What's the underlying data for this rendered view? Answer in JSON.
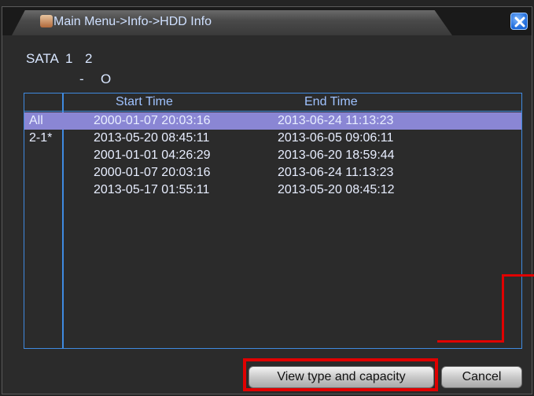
{
  "window": {
    "title": "Main Menu->Info->HDD Info"
  },
  "sata": {
    "label": "SATA",
    "ports": [
      "1",
      "2"
    ],
    "status": [
      "-",
      "O"
    ]
  },
  "table": {
    "headers": {
      "start": "Start Time",
      "end": "End Time"
    },
    "rows": [
      {
        "tag": "All",
        "start": "2000-01-07 20:03:16",
        "end": "2013-06-24 11:13:23",
        "selected": true
      },
      {
        "tag": "2-1*",
        "start": "2013-05-20 08:45:11",
        "end": "2013-06-05 09:06:11",
        "selected": false
      },
      {
        "tag": "",
        "start": "2001-01-01 04:26:29",
        "end": "2013-06-20 18:59:44",
        "selected": false
      },
      {
        "tag": "",
        "start": "2000-01-07 20:03:16",
        "end": "2013-06-24 11:13:23",
        "selected": false
      },
      {
        "tag": "",
        "start": "2013-05-17 01:55:11",
        "end": "2013-05-20 08:45:12",
        "selected": false
      }
    ]
  },
  "buttons": {
    "view": "View type and capacity",
    "cancel": "Cancel"
  },
  "colors": {
    "accent_border": "#3f8ae0",
    "selection": "#8a86d4",
    "highlight": "#e00000"
  },
  "icons": {
    "title": "hdd-info-icon",
    "close": "close-icon"
  }
}
